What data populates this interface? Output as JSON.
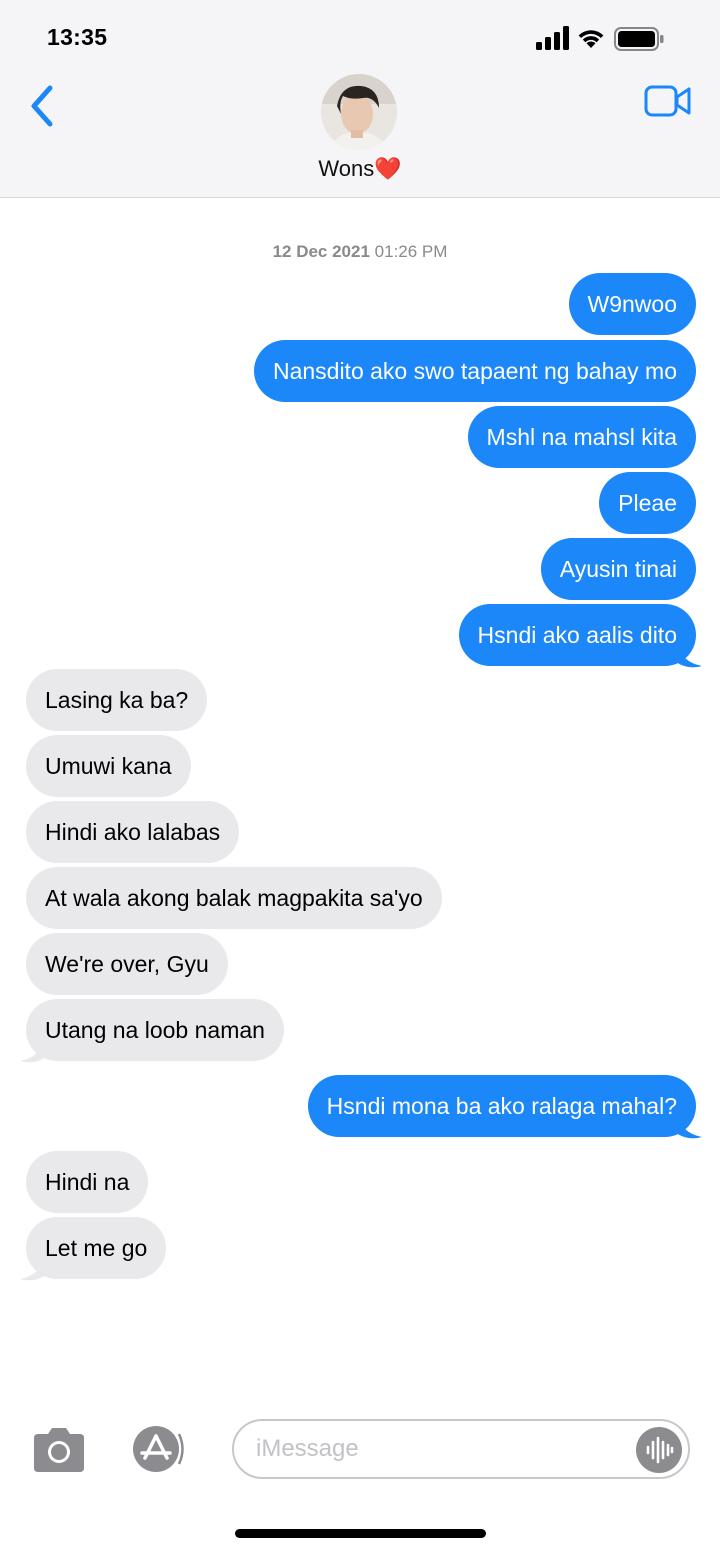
{
  "status_bar": {
    "time": "13:35"
  },
  "header": {
    "contact_name": "Wons",
    "contact_emoji": "❤️"
  },
  "conversation": {
    "timestamp_date": "12 Dec 2021",
    "timestamp_time": "01:26 PM",
    "messages": [
      {
        "direction": "sent",
        "text": "W9nwoo"
      },
      {
        "direction": "sent",
        "text": "Nansdito ako swo tapaent ng bahay mo"
      },
      {
        "direction": "sent",
        "text": "Mshl na mahsl kita"
      },
      {
        "direction": "sent",
        "text": "Pleae"
      },
      {
        "direction": "sent",
        "text": "Ayusin tinai"
      },
      {
        "direction": "sent",
        "text": "Hsndi ako aalis dito"
      },
      {
        "direction": "received",
        "text": "Lasing ka ba?"
      },
      {
        "direction": "received",
        "text": "Umuwi kana"
      },
      {
        "direction": "received",
        "text": "Hindi ako lalabas"
      },
      {
        "direction": "received",
        "text": "At wala akong balak magpakita sa'yo"
      },
      {
        "direction": "received",
        "text": "We're over, Gyu"
      },
      {
        "direction": "received",
        "text": "Utang na loob naman"
      },
      {
        "direction": "sent",
        "text": "Hsndi mona ba ako ralaga mahal?"
      },
      {
        "direction": "received",
        "text": "Hindi na"
      },
      {
        "direction": "received",
        "text": "Let me go"
      }
    ]
  },
  "input_bar": {
    "placeholder": "iMessage",
    "value": ""
  },
  "icons": {
    "back": "chevron-left-icon",
    "video": "video-camera-icon",
    "camera": "camera-icon",
    "apps": "app-store-icon",
    "audio": "audio-waveform-icon",
    "signal": "signal-icon",
    "wifi": "wifi-icon",
    "battery": "battery-icon"
  },
  "colors": {
    "accent": "#1c87f9",
    "sent_bubble": "#1c87f9",
    "received_bubble": "#e9e9eb",
    "header_bg": "#f5f5f7",
    "heart": "#e0152b"
  }
}
